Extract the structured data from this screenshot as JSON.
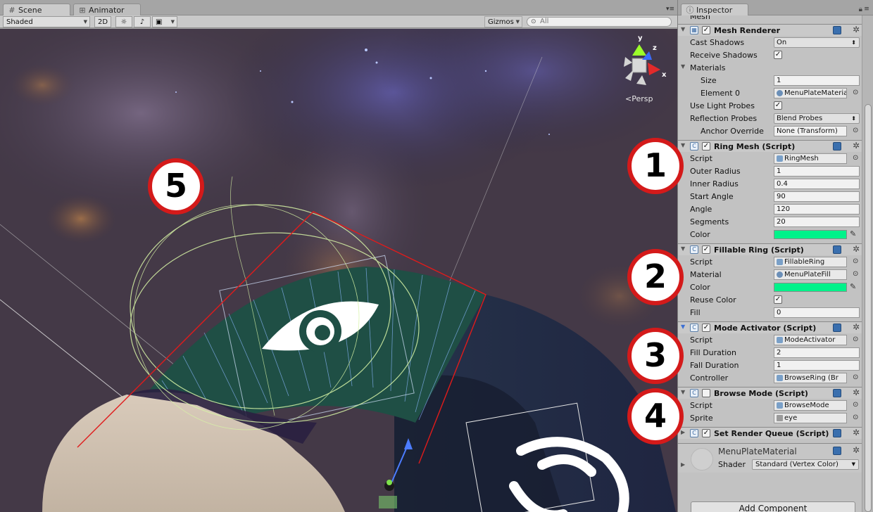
{
  "scene": {
    "tabs": [
      {
        "label": "Scene",
        "icon": "grid-icon"
      },
      {
        "label": "Animator",
        "icon": "animator-icon"
      }
    ],
    "toolbar": {
      "shading_mode": "Shaded",
      "mode_2d": "2D",
      "gizmos": "Gizmos",
      "search_placeholder": "All"
    },
    "gizmo": {
      "axis_y": "y",
      "axis_z": "z",
      "axis_x": "x",
      "projection": "Persp"
    }
  },
  "inspector": {
    "tab_label": "Inspector",
    "top_cut_label": "Mesh",
    "components": {
      "mesh_renderer": {
        "title": "Mesh Renderer",
        "cast_shadows_label": "Cast Shadows",
        "cast_shadows_value": "On",
        "receive_shadows_label": "Receive Shadows",
        "materials_label": "Materials",
        "size_label": "Size",
        "size_value": "1",
        "element0_label": "Element 0",
        "element0_value": "MenuPlateMaterial",
        "light_probes_label": "Use Light Probes",
        "reflection_probes_label": "Reflection Probes",
        "reflection_probes_value": "Blend Probes",
        "anchor_label": "Anchor Override",
        "anchor_value": "None (Transform)"
      },
      "ring_mesh": {
        "title": "Ring Mesh (Script)",
        "script_label": "Script",
        "script_value": "RingMesh",
        "outer_radius_label": "Outer Radius",
        "outer_radius_value": "1",
        "inner_radius_label": "Inner Radius",
        "inner_radius_value": "0.4",
        "start_angle_label": "Start Angle",
        "start_angle_value": "90",
        "angle_label": "Angle",
        "angle_value": "120",
        "segments_label": "Segments",
        "segments_value": "20",
        "color_label": "Color"
      },
      "fillable_ring": {
        "title": "Fillable Ring (Script)",
        "script_label": "Script",
        "script_value": "FillableRing",
        "material_label": "Material",
        "material_value": "MenuPlateFill",
        "color_label": "Color",
        "reuse_color_label": "Reuse Color",
        "fill_label": "Fill",
        "fill_value": "0"
      },
      "mode_activator": {
        "title": "Mode Activator (Script)",
        "script_label": "Script",
        "script_value": "ModeActivator",
        "fill_duration_label": "Fill Duration",
        "fill_duration_value": "2",
        "fall_duration_label": "Fall Duration",
        "fall_duration_value": "1",
        "controller_label": "Controller",
        "controller_value": "BrowseRing (Br"
      },
      "browse_mode": {
        "title": "Browse Mode (Script)",
        "script_label": "Script",
        "script_value": "BrowseMode",
        "sprite_label": "Sprite",
        "sprite_value": "eye"
      },
      "set_render_queue": {
        "title": "Set Render Queue (Script)"
      }
    },
    "material": {
      "name": "MenuPlateMaterial",
      "shader_label": "Shader",
      "shader_value": "Standard (Vertex Color)"
    },
    "add_component": "Add Component"
  },
  "callouts": [
    "1",
    "2",
    "3",
    "4",
    "5"
  ],
  "colors": {
    "ring_color": "#00f28a",
    "callout_border": "#d41a1a",
    "selection_outline": "#e01b1b"
  }
}
